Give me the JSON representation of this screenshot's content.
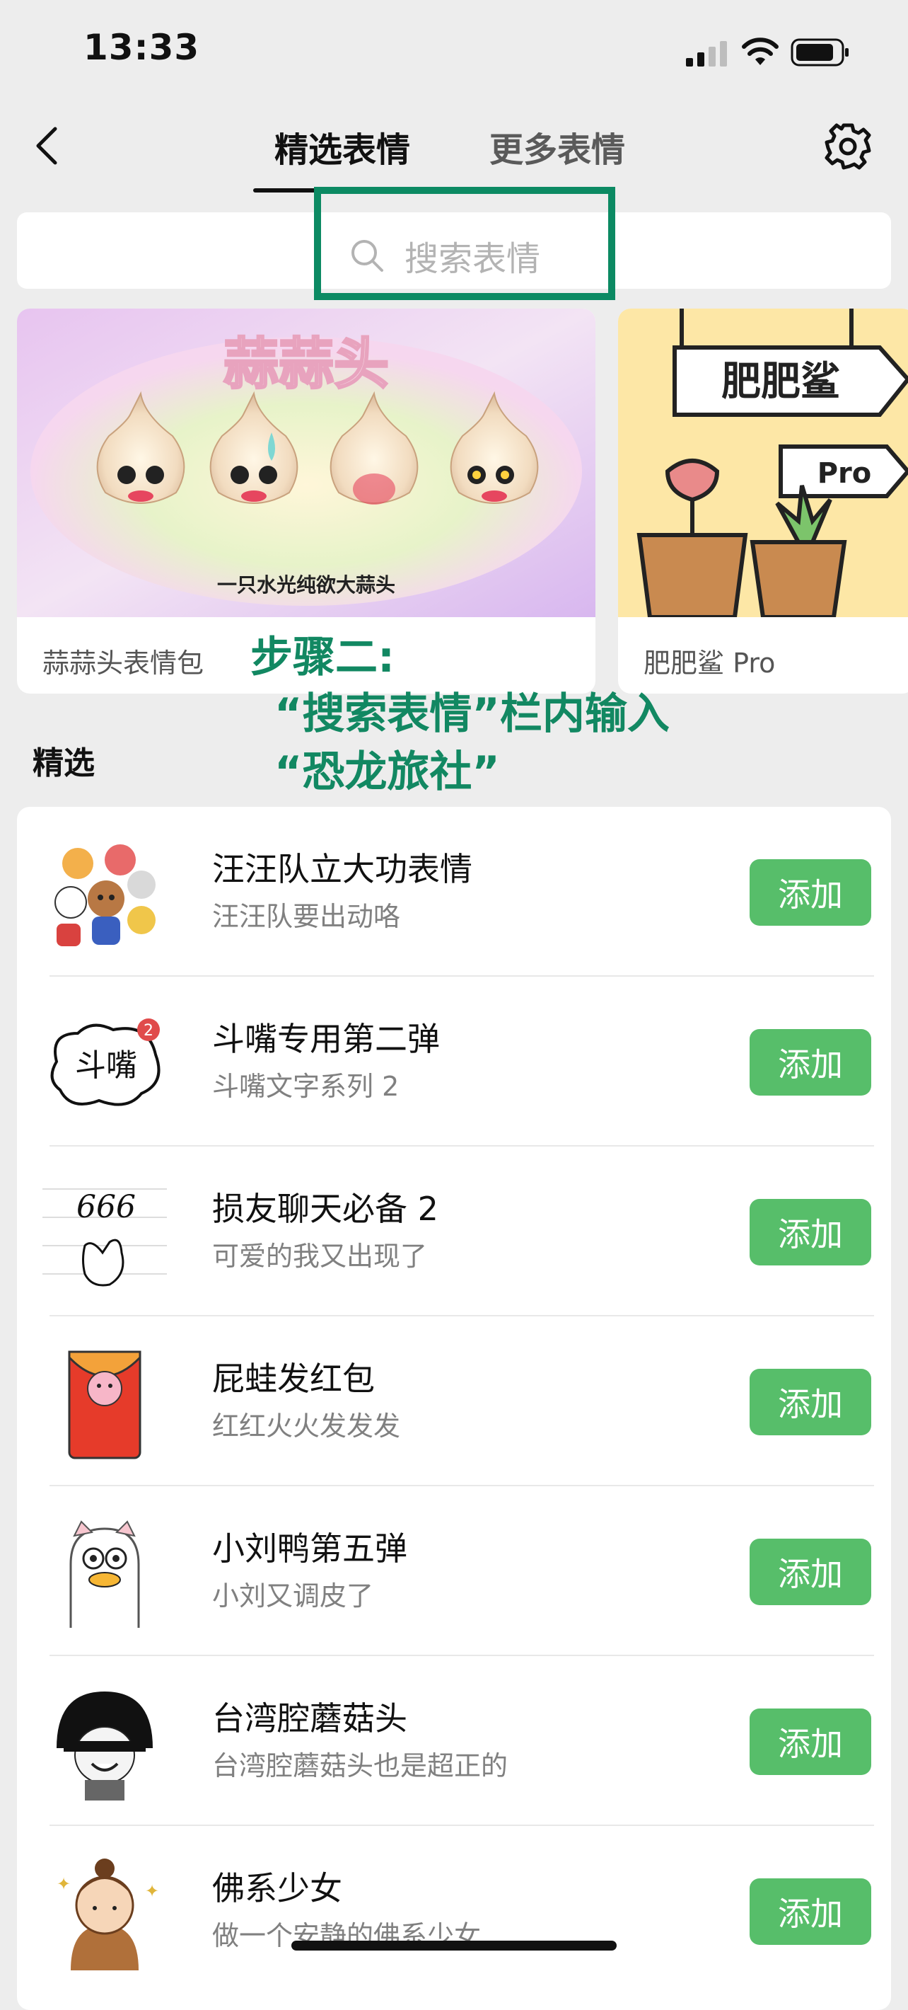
{
  "status_bar": {
    "time": "13:33"
  },
  "nav": {
    "tabs": [
      {
        "label": "精选表情",
        "active": true
      },
      {
        "label": "更多表情",
        "active": false
      }
    ]
  },
  "search": {
    "placeholder": "搜索表情"
  },
  "banners": [
    {
      "label": "蒜蒜头表情包",
      "art_title": "蒜蒜头",
      "art_caption": "一只水光纯欲大蒜头"
    },
    {
      "label": "肥肥鲨 Pro",
      "art_sign_1": "肥肥鲨",
      "art_sign_2": "Pro"
    }
  ],
  "annotation": {
    "line1": "步骤二:",
    "line2": "“搜索表情”栏内输入",
    "line3": "“恐龙旅社”",
    "color": "#128862"
  },
  "section": {
    "title": "精选"
  },
  "items": [
    {
      "title": "汪汪队立大功表情",
      "subtitle": "汪汪队要出动咯",
      "button": "添加"
    },
    {
      "title": "斗嘴专用第二弹",
      "subtitle": "斗嘴文字系列 2",
      "button": "添加",
      "thumb_text": "斗嘴",
      "thumb_badge": "2"
    },
    {
      "title": "损友聊天必备 2",
      "subtitle": "可爱的我又出现了",
      "button": "添加",
      "thumb_text": "666"
    },
    {
      "title": "屁蛙发红包",
      "subtitle": "红红火火发发发",
      "button": "添加"
    },
    {
      "title": "小刘鸭第五弹",
      "subtitle": "小刘又调皮了",
      "button": "添加"
    },
    {
      "title": "台湾腔蘑菇头",
      "subtitle": "台湾腔蘑菇头也是超正的",
      "button": "添加"
    },
    {
      "title": "佛系少女",
      "subtitle": "做一个安静的佛系少女",
      "button": "添加"
    }
  ],
  "colors": {
    "accent": "#57BE6A",
    "background": "#EDEDED"
  }
}
